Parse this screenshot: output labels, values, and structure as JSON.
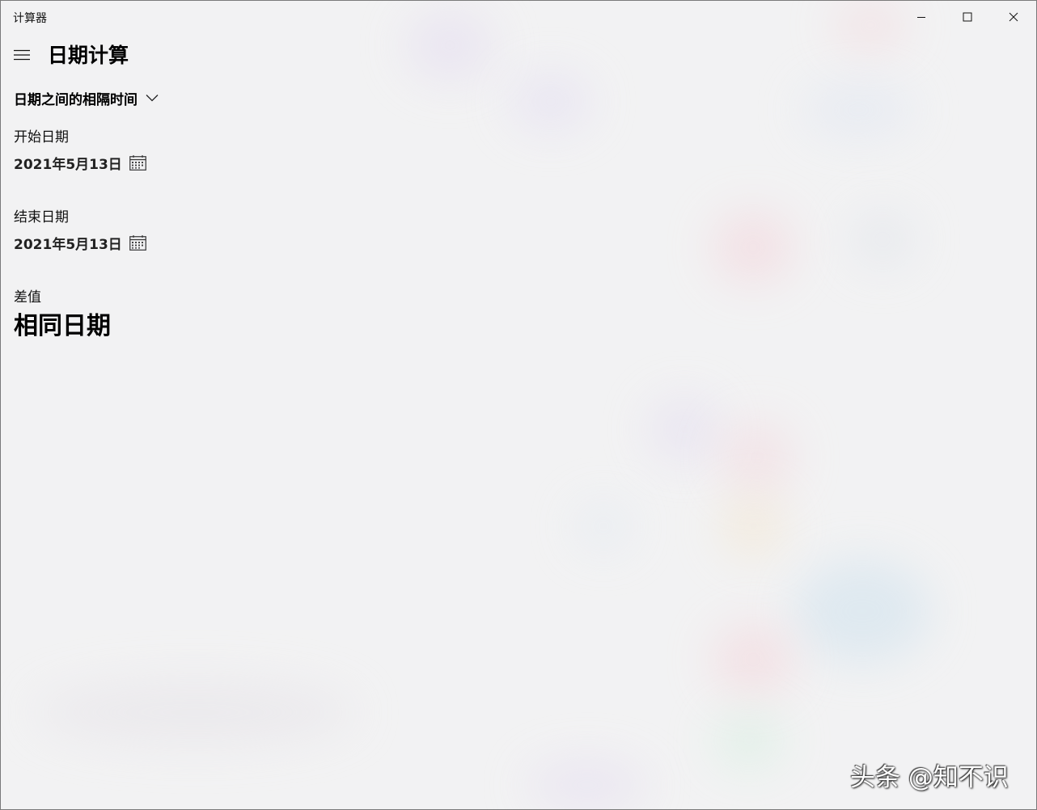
{
  "window": {
    "title": "计算器"
  },
  "header": {
    "page_title": "日期计算"
  },
  "mode": {
    "selected": "日期之间的相隔时间"
  },
  "start": {
    "label": "开始日期",
    "value": "2021年5月13日"
  },
  "end": {
    "label": "结束日期",
    "value": "2021年5月13日"
  },
  "difference": {
    "label": "差值",
    "value": "相同日期"
  },
  "watermark": {
    "text": "头条 @知不识"
  },
  "icons": {
    "menu": "hamburger-icon",
    "dropdown": "chevron-down-icon",
    "calendar": "calendar-icon",
    "minimize": "minimize-icon",
    "maximize": "maximize-icon",
    "close": "close-icon"
  },
  "colors": {
    "background": "#f2f2f3",
    "text": "#000000"
  }
}
